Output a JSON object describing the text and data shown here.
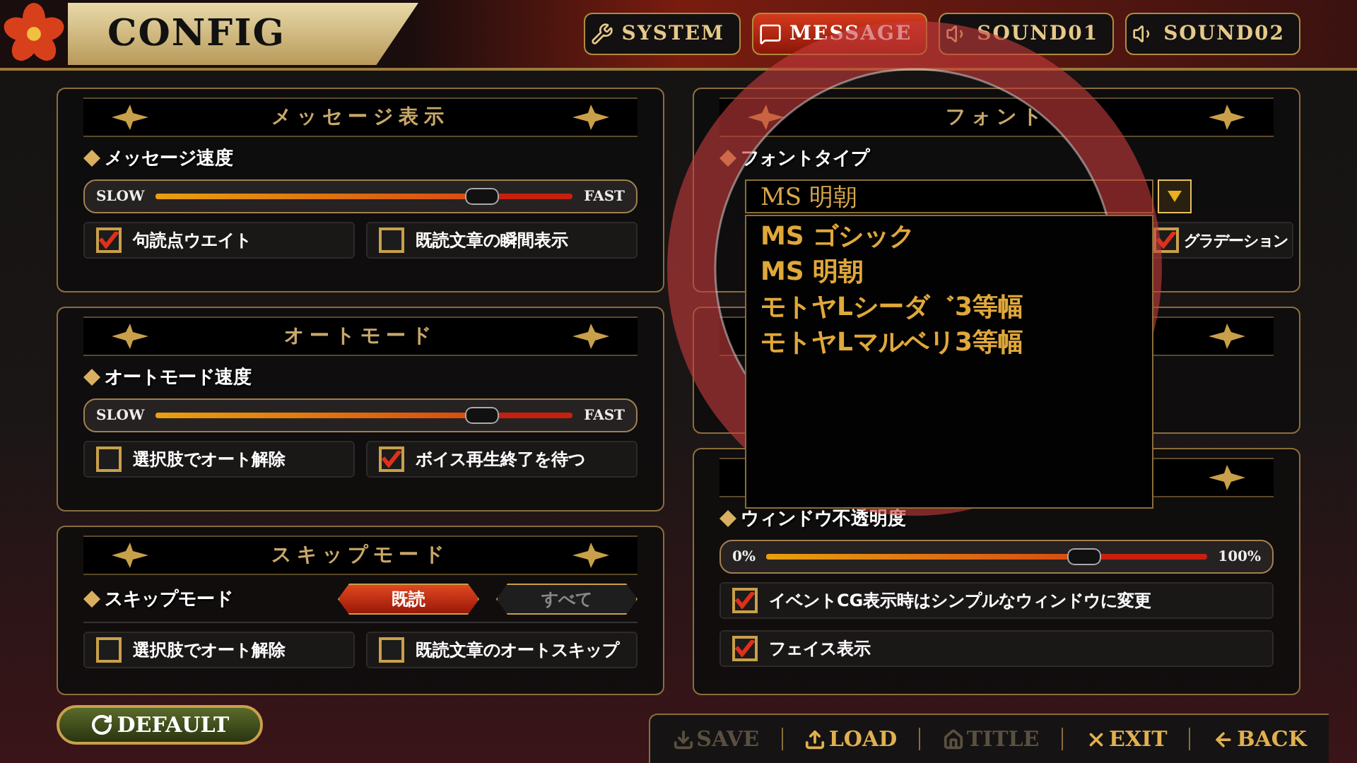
{
  "header": {
    "title": "CONFIG",
    "tabs": [
      {
        "label": "SYSTEM",
        "selected": false
      },
      {
        "label": "MESSAGE",
        "selected": true
      },
      {
        "label": "SOUND01",
        "selected": false
      },
      {
        "label": "SOUND02",
        "selected": false
      }
    ]
  },
  "left_panels": [
    {
      "kind": "normal",
      "title": "メッセージ表示",
      "rows": [
        {
          "kind": "slider",
          "label": "メッセージ速度",
          "min_label": "SLOW",
          "max_label": "FAST",
          "level": 0.78
        },
        {
          "kind": "checks",
          "items": [
            {
              "label": "句読点ウエイト",
              "checked": true
            },
            {
              "label": "既読文章の瞬間表示",
              "checked": false
            }
          ]
        }
      ]
    },
    {
      "kind": "normal",
      "title": "オートモード",
      "rows": [
        {
          "kind": "slider",
          "label": "オートモード速度",
          "min_label": "SLOW",
          "max_label": "FAST",
          "level": 0.78
        },
        {
          "kind": "checks",
          "items": [
            {
              "label": "選択肢でオート解除",
              "checked": false
            },
            {
              "label": "ボイス再生終了を待つ",
              "checked": true
            }
          ]
        }
      ]
    },
    {
      "kind": "normal",
      "title": "スキップモード",
      "rows": [
        {
          "kind": "choice",
          "label": "スキップモード",
          "options": [
            {
              "label": "既読",
              "selected": true
            },
            {
              "label": "すべて",
              "selected": false
            }
          ]
        },
        {
          "kind": "checks",
          "items": [
            {
              "label": "選択肢でオート解除",
              "checked": false
            },
            {
              "label": "既読文章のオートスキップ",
              "checked": false
            }
          ]
        }
      ]
    }
  ],
  "right_panels": [
    {
      "kind": "normal",
      "title": "フォント",
      "rows": [
        {
          "kind": "dropdown",
          "label": "フォントタイプ",
          "value": "MS 明朝",
          "expanded": true,
          "options": [
            "MS ゴシック",
            "MS 明朝",
            "モトヤLシーダ゛3等幅",
            "モトヤLマルベリ3等幅"
          ]
        },
        {
          "kind": "checks",
          "items": [
            {
              "label": "グラデーション",
              "checked": true
            }
          ]
        }
      ]
    },
    {
      "kind": "covered"
    },
    {
      "kind": "untitled",
      "rows": [
        {
          "kind": "slider",
          "label": "ウィンドウ不透明度",
          "min_label": "0%",
          "max_label": "100%",
          "level": 0.72
        },
        {
          "kind": "stack",
          "items": [
            {
              "label": "イベントCG表示時はシンプルなウィンドウに変更",
              "checked": true
            },
            {
              "label": "フェイス表示",
              "checked": true
            }
          ]
        }
      ]
    }
  ],
  "default_button": "DEFAULT",
  "footer": [
    {
      "label": "SAVE",
      "disabled": true
    },
    {
      "label": "LOAD",
      "disabled": false
    },
    {
      "label": "TITLE",
      "disabled": true
    },
    {
      "label": "EXIT",
      "disabled": false
    },
    {
      "label": "BACK",
      "disabled": false
    }
  ]
}
